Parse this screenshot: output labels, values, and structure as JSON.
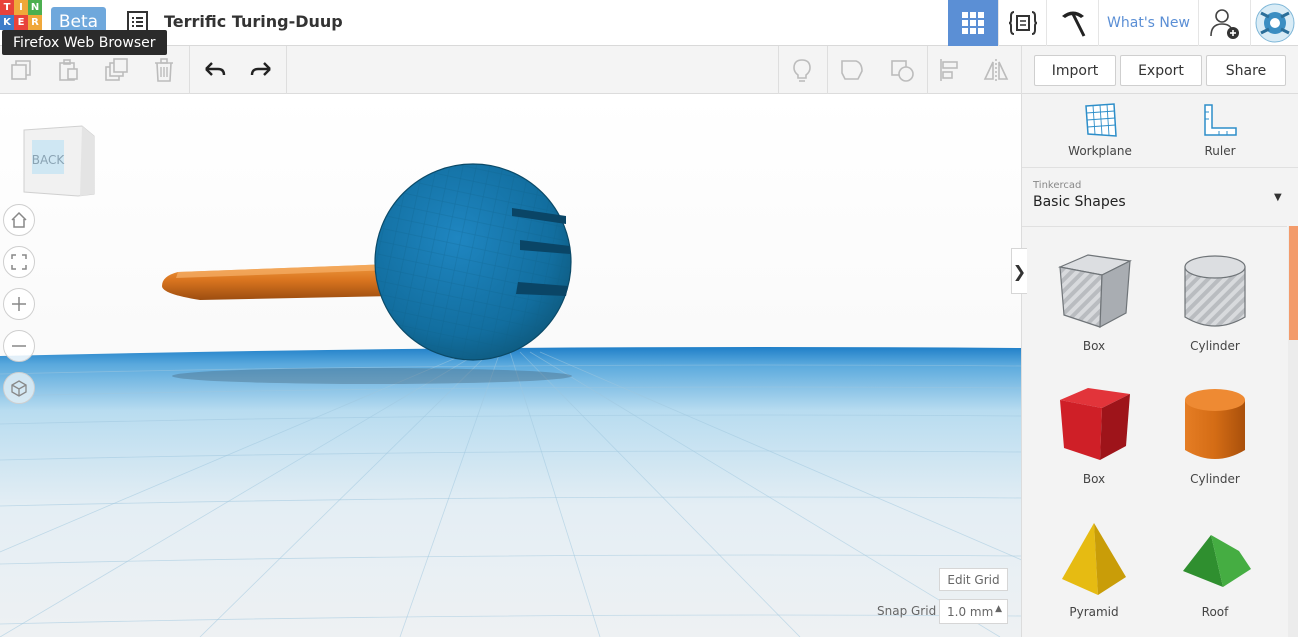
{
  "logo": {
    "letters": [
      "T",
      "I",
      "N",
      "K",
      "E",
      "R"
    ],
    "colors": [
      "#e8423a",
      "#f0a83a",
      "#4caf50",
      "#3d7cc9",
      "#e8423a",
      "#f0a83a"
    ]
  },
  "header": {
    "beta_label": "Beta",
    "design_title": "Terrific Turing-Duup",
    "tooltip": "Firefox Web Browser",
    "whats_new": "What's New",
    "accent": "#5b8fd5"
  },
  "toolbar": {
    "import_label": "Import",
    "export_label": "Export",
    "share_label": "Share"
  },
  "viewcube": {
    "face_label": "BACK"
  },
  "grid": {
    "edit_label": "Edit Grid",
    "snap_label": "Snap Grid",
    "snap_value": "1.0 mm"
  },
  "panel": {
    "workplane_label": "Workplane",
    "ruler_label": "Ruler",
    "library_source": "Tinkercad",
    "library_name": "Basic Shapes",
    "collapse_glyph": "❯",
    "shapes": [
      {
        "label": "Box",
        "kind": "box-hole"
      },
      {
        "label": "Cylinder",
        "kind": "cylinder-hole"
      },
      {
        "label": "Box",
        "kind": "box-solid",
        "color": "#d62329"
      },
      {
        "label": "Cylinder",
        "kind": "cylinder-solid",
        "color": "#e0741c"
      },
      {
        "label": "Pyramid",
        "kind": "pyramid",
        "color": "#f0c419"
      },
      {
        "label": "Roof",
        "kind": "roof",
        "color": "#3aa23a"
      }
    ]
  }
}
